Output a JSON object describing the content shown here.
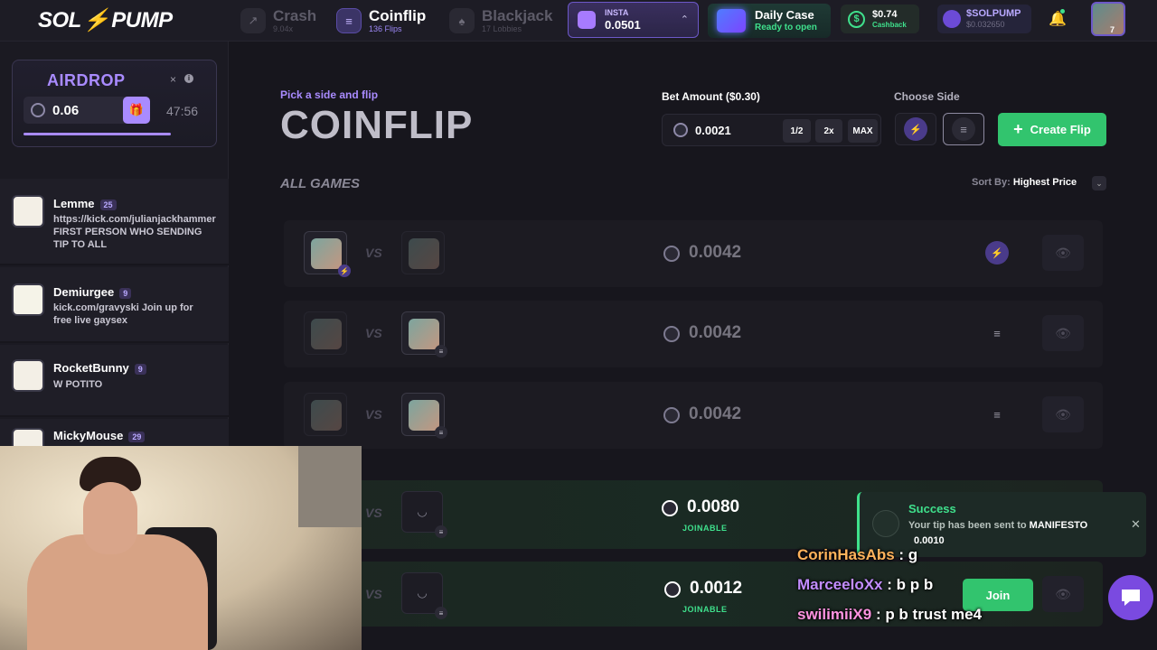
{
  "brand": {
    "logo_left": "SOL",
    "logo_right": "PUMP"
  },
  "nav": [
    {
      "title": "Crash",
      "sub": "9.04x",
      "icon": "trend-icon"
    },
    {
      "title": "Coinflip",
      "sub": "136 Flips",
      "icon": "coin-icon"
    },
    {
      "title": "Blackjack",
      "sub": "17 Lobbies",
      "icon": "cards-icon"
    }
  ],
  "insta": {
    "label": "INSTA",
    "value": "0.0501"
  },
  "daily_case": {
    "title": "Daily Case",
    "status": "Ready to open"
  },
  "cashback": {
    "value": "$0.74",
    "label": "Cashback"
  },
  "token": {
    "name": "$SOLPUMP",
    "price": "$0.032650"
  },
  "user": {
    "level": "7"
  },
  "airdrop": {
    "title": "AIRDROP",
    "close": "×",
    "info": "i",
    "amount": "0.06",
    "timer": "47:56",
    "progress": 0.72
  },
  "chat": [
    {
      "name": "Lemme",
      "level": "25",
      "text": "https://kick.com/julianjackhammer FIRST PERSON WHO SENDING TIP TO ALL"
    },
    {
      "name": "Demiurgee",
      "level": "9",
      "text": "kick.com/gravyski Join up for free live gaysex"
    },
    {
      "name": "RocketBunny",
      "level": "9",
      "text": "W POTITO"
    },
    {
      "name": "MickyMouse",
      "level": "29",
      "text": ""
    }
  ],
  "header": {
    "eyebrow": "Pick a side and flip",
    "title": "COINFLIP"
  },
  "bet": {
    "label": "Bet Amount",
    "usd": "($0.30)",
    "value": "0.0021",
    "half": "1/2",
    "double": "2x",
    "max": "MAX"
  },
  "side": {
    "label": "Choose Side"
  },
  "create_label": "Create Flip",
  "games": {
    "title": "ALL GAMES",
    "sort_label": "Sort By:",
    "sort_value": "Highest Price"
  },
  "rows": [
    {
      "amount": "0.0042",
      "joinable": ""
    },
    {
      "amount": "0.0042",
      "joinable": ""
    },
    {
      "amount": "0.0042",
      "joinable": ""
    },
    {
      "amount": "0.0080",
      "joinable": "JOINABLE"
    },
    {
      "amount": "0.0012",
      "joinable": "JOINABLE",
      "action": "Join"
    }
  ],
  "toast": {
    "title": "Success",
    "text": "Your tip has been sent to",
    "recipient": "MANIFESTO",
    "amount": "0.0010"
  },
  "overlay_chat": [
    {
      "name": "CorinHasAbs",
      "text": ": g"
    },
    {
      "name": "MarceeloXx",
      "text": ": b p b"
    },
    {
      "name": "swilimiiX9",
      "text": ": p b trust me4"
    }
  ],
  "colors": {
    "accent": "#a98bff",
    "green": "#32c46e",
    "bg": "#16151c"
  }
}
